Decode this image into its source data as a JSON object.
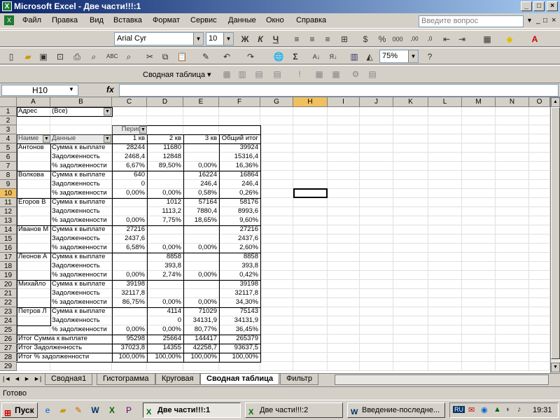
{
  "window": {
    "title": "Microsoft Excel - Две части!!!:1",
    "title_colors": [
      "#0a246a",
      "#a6caf0"
    ]
  },
  "menu": [
    "Файл",
    "Правка",
    "Вид",
    "Вставка",
    "Формат",
    "Сервис",
    "Данные",
    "Окно",
    "Справка"
  ],
  "help_placeholder": "Введите вопрос",
  "format_toolbar": {
    "font": "Arial Cyr",
    "size": "10",
    "bold": "Ж",
    "italic": "К",
    "underline": "Ч"
  },
  "standard_toolbar": {
    "zoom": "75%"
  },
  "pivot_toolbar": {
    "label": "Сводная таблица ▾"
  },
  "formula_bar": {
    "name_box": "H10",
    "fx": "fx",
    "formula": ""
  },
  "columns": [
    "A",
    "B",
    "C",
    "D",
    "E",
    "F",
    "G",
    "H",
    "I",
    "J",
    "K",
    "L",
    "M",
    "N",
    "O"
  ],
  "rows": [
    [
      "1",
      "Адрес",
      "(Все)",
      "",
      "",
      "",
      ""
    ],
    [
      "2",
      "",
      "",
      "",
      "",
      "",
      ""
    ],
    [
      "3",
      "",
      "",
      "Период",
      "",
      "",
      ""
    ],
    [
      "4",
      "Наиме",
      "Данные",
      "1 кв",
      "2 кв",
      "3 кв",
      "Общий итог"
    ],
    [
      "5",
      "Антонов",
      "Сумма к выплате",
      "28244",
      "11680",
      "",
      "39924"
    ],
    [
      "6",
      "",
      "Задолженность",
      "2468,4",
      "12848",
      "",
      "15316,4"
    ],
    [
      "7",
      "",
      "% задолженности",
      "6,67%",
      "89,50%",
      "0,00%",
      "16,36%"
    ],
    [
      "8",
      "Волкова",
      "Сумма к выплате",
      "640",
      "",
      "16224",
      "16864"
    ],
    [
      "9",
      "",
      "Задолженность",
      "0",
      "",
      "246,4",
      "246,4"
    ],
    [
      "10",
      "",
      "% задолженности",
      "0,00%",
      "0,00%",
      "0,58%",
      "0,26%"
    ],
    [
      "11",
      "Егоров В",
      "Сумма к выплате",
      "",
      "1012",
      "57164",
      "58176"
    ],
    [
      "12",
      "",
      "Задолженность",
      "",
      "1113,2",
      "7880,4",
      "8993,6"
    ],
    [
      "13",
      "",
      "% задолженности",
      "0,00%",
      "7,75%",
      "18,65%",
      "9,60%"
    ],
    [
      "14",
      "Иванов М",
      "Сумма к выплате",
      "27216",
      "",
      "",
      "27216"
    ],
    [
      "15",
      "",
      "Задолженность",
      "2437,6",
      "",
      "",
      "2437,6"
    ],
    [
      "16",
      "",
      "% задолженности",
      "6,58%",
      "0,00%",
      "0,00%",
      "2,60%"
    ],
    [
      "17",
      "Леонов А",
      "Сумма к выплате",
      "",
      "8858",
      "",
      "8858"
    ],
    [
      "18",
      "",
      "Задолженность",
      "",
      "393,8",
      "",
      "393,8"
    ],
    [
      "19",
      "",
      "% задолженности",
      "0,00%",
      "2,74%",
      "0,00%",
      "0,42%"
    ],
    [
      "20",
      "Михайло",
      "Сумма к выплате",
      "39198",
      "",
      "",
      "39198"
    ],
    [
      "21",
      "",
      "Задолженность",
      "32117,8",
      "",
      "",
      "32117,8"
    ],
    [
      "22",
      "",
      "% задолженности",
      "86,75%",
      "0,00%",
      "0,00%",
      "34,30%"
    ],
    [
      "23",
      "Петров Л",
      "Сумма к выплате",
      "",
      "4114",
      "71029",
      "75143"
    ],
    [
      "24",
      "",
      "Задолженность",
      "",
      "0",
      "34131,9",
      "34131,9"
    ],
    [
      "25",
      "",
      "% задолженности",
      "0,00%",
      "0,00%",
      "80,77%",
      "36,45%"
    ],
    [
      "26",
      "Итог Сумма к выплате",
      "",
      "95298",
      "25664",
      "144417",
      "265379"
    ],
    [
      "27",
      "Итог Задолженность",
      "",
      "37023,8",
      "14355",
      "42258,7",
      "93637,5"
    ],
    [
      "28",
      "Итог % задолженности",
      "",
      "100,00%",
      "100,00%",
      "100,00%",
      "100,00%"
    ]
  ],
  "sheet_tabs": [
    "Сводная1",
    "Гистограмма",
    "Круговая",
    "Сводная таблица",
    "Фильтр"
  ],
  "active_tab": "Сводная таблица",
  "status": "Готово",
  "taskbar": {
    "start": "Пуск",
    "tasks": [
      "Две части!!!:1",
      "Две части!!!:2",
      "Введение-последне..."
    ],
    "lang": "RU",
    "clock": "19:31"
  }
}
